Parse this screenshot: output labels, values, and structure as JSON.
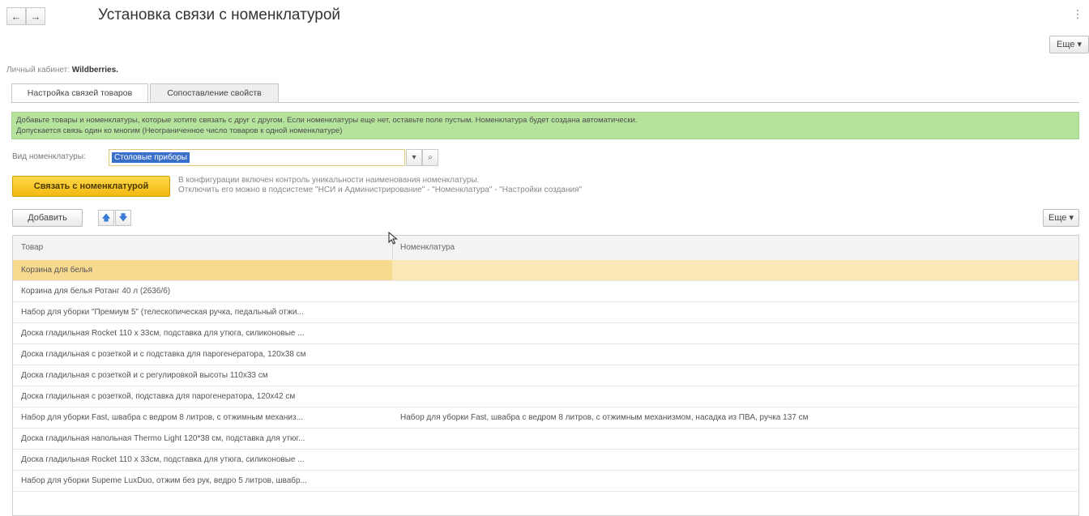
{
  "window": {
    "back_glyph": "←",
    "forward_glyph": "→",
    "title": "Установка связи с номенклатурой",
    "more_top_glyph": "⋮",
    "more_button": "Еще ▾"
  },
  "cabinet": {
    "label": "Личный кабинет:",
    "value": "Wildberries."
  },
  "tabs": [
    {
      "label": "Настройка связей товаров"
    },
    {
      "label": "Сопоставление свойств"
    }
  ],
  "info": {
    "line1": "Добавьте товары и номенклатуры, которые хотите связать с друг с другом. Если номенклатуры еще нет, оставьте поле пустым. Номенклатура будет создана автоматически.",
    "line2": "Допускается связь один ко многим (Неограниченное число товаров к одной номенклатуре)"
  },
  "nomenclature_kind": {
    "label": "Вид номенклатуры:",
    "value": "Столовые приборы",
    "dropdown_glyph": "▾",
    "open_glyph": "⌕"
  },
  "link_button": "Связать с номенклатурой",
  "hint": {
    "line1": "В конфигурации включен контроль уникальности наименования номенклатуры.",
    "line2": "Отключить его можно в подсистеме \"НСИ и Администрирование\" - \"Номенклатура\" - \"Настройки создания\""
  },
  "toolbar": {
    "add": "Добавить",
    "up_glyph": "🡅",
    "down_glyph": "🡇",
    "more": "Еще ▾"
  },
  "table": {
    "headers": [
      "Товар",
      "Номенклатура"
    ],
    "rows": [
      {
        "product": "Корзина для белья",
        "nomenclature": ""
      },
      {
        "product": "Корзина для белья Ротанг 40 л (2636/6)",
        "nomenclature": ""
      },
      {
        "product": "Набор для уборки \"Премиум 5\" (телескопическая ручка, педальный отжи...",
        "nomenclature": ""
      },
      {
        "product": "Доска гладильная Rocket 110 x 33см, подставка для утюга, силиконовые ...",
        "nomenclature": ""
      },
      {
        "product": "Доска гладильная с розеткой и с подставка для парогенератора, 120х38 см",
        "nomenclature": ""
      },
      {
        "product": "Доска гладильная с розеткой и с регулировкой высоты 110х33 см",
        "nomenclature": ""
      },
      {
        "product": "Доска гладильная с розеткой, подставка для парогенератора, 120х42 см",
        "nomenclature": ""
      },
      {
        "product": "Набор для уборки Fast, швабра с ведром 8 литров, с отжимным механиз...",
        "nomenclature": "Набор для уборки Fast, швабра с ведром 8 литров, с отжимным механизмом, насадка из ПВА, ручка 137 см"
      },
      {
        "product": "Доска гладильная напольная Thermo Light 120*38 см, подставка для утюг...",
        "nomenclature": ""
      },
      {
        "product": "Доска гладильная Rocket 110 x 33см, подставка для утюга, силиконовые ...",
        "nomenclature": ""
      },
      {
        "product": "Набор для уборки Supeme LuxDuo, отжим без рук, ведро 5 литров, швабр...",
        "nomenclature": ""
      }
    ],
    "selected_row": 0
  }
}
